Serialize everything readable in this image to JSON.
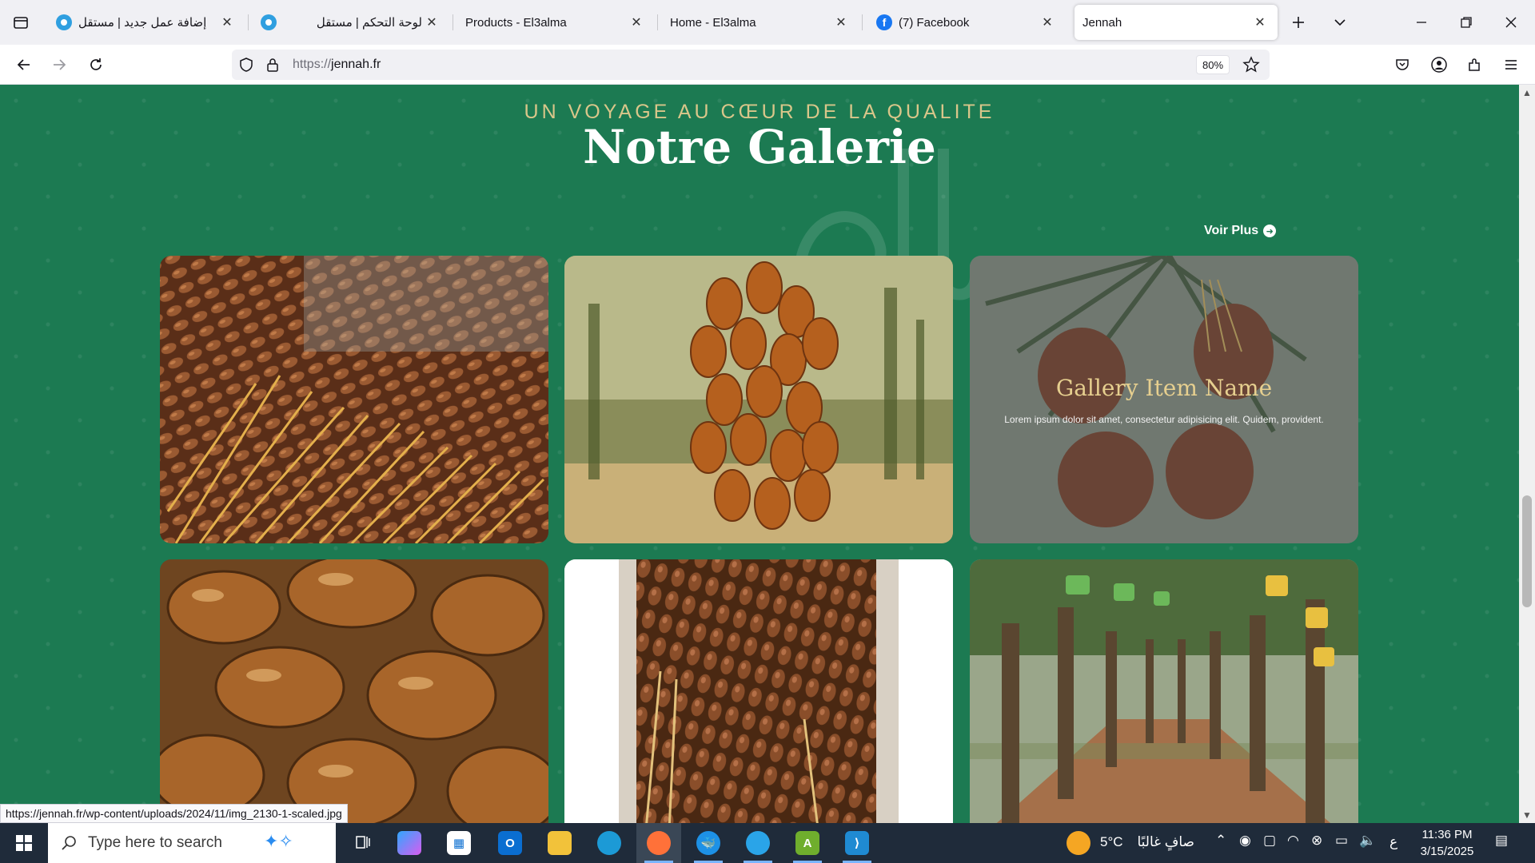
{
  "browser": {
    "tabs": [
      {
        "title": "إضافة عمل جديد | مستقل",
        "favicon": "mostaql-icon"
      },
      {
        "title": "لوحة التحكم | مستقل",
        "favicon": "mostaql-icon"
      },
      {
        "title": "Products - El3alma",
        "favicon": ""
      },
      {
        "title": "Home - El3alma",
        "favicon": ""
      },
      {
        "title": "(7) Facebook",
        "favicon": "facebook-icon"
      },
      {
        "title": "Jennah",
        "favicon": "",
        "active": true
      }
    ],
    "url_scheme": "https://",
    "url_host": "jennah.fr",
    "zoom": "80%",
    "status_url": "https://jennah.fr/wp-content/uploads/2024/11/img_2130-1-scaled.jpg"
  },
  "page": {
    "eyebrow": "UN VOYAGE AU CŒUR DE LA QUALITE",
    "title": "Notre Galerie",
    "voir_plus": "Voir Plus",
    "gallery_overlay": {
      "name": "Gallery Item Name",
      "description": "Lorem ipsum dolor sit amet, consectetur adipisicing elit. Quidem, provident."
    },
    "colors": {
      "background": "#1c7a52",
      "accent": "#d9c68a"
    }
  },
  "taskbar": {
    "search_placeholder": "Type here to search",
    "weather_temp": "5°C",
    "weather_text": "صافٍ غالبًا",
    "lang": "ع",
    "time": "11:36 PM",
    "date": "3/15/2025"
  }
}
